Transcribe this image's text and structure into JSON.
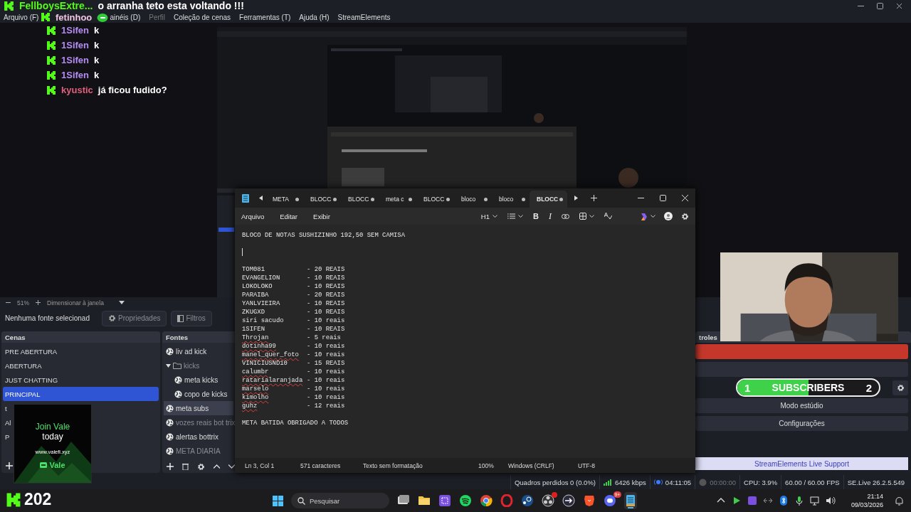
{
  "chat_overlay": {
    "messages": [
      {
        "kind": "title",
        "user": "FellboysExtre...",
        "text": "o arranha teto esta voltando !!!",
        "color": "#53fc18"
      },
      {
        "kind": "emote",
        "user": "fetinhoo",
        "color": "#f2c4e4"
      },
      {
        "kind": "text",
        "user": "1Sifen",
        "text": "k",
        "color": "#b48cf2"
      },
      {
        "kind": "text",
        "user": "1Sifen",
        "text": "k",
        "color": "#b48cf2"
      },
      {
        "kind": "text",
        "user": "1Sifen",
        "text": "k",
        "color": "#b48cf2"
      },
      {
        "kind": "text",
        "user": "1Sifen",
        "text": "k",
        "color": "#b48cf2"
      },
      {
        "kind": "text",
        "user": "kyustic",
        "text": "já ficou fudido?",
        "color": "#e0607e"
      }
    ]
  },
  "menu": [
    {
      "label": "Arquivo (F)",
      "disabled": false
    },
    {
      "label": "ainéis (D)",
      "disabled": false
    },
    {
      "label": "Perfil",
      "disabled": true
    },
    {
      "label": "Coleção de cenas",
      "disabled": false
    },
    {
      "label": "Ferramentas (T)",
      "disabled": false
    },
    {
      "label": "Ajuda (H)",
      "disabled": false
    },
    {
      "label": "StreamElements",
      "disabled": false
    }
  ],
  "preview": {
    "zoom": "51%",
    "fit": "Dimensionar à janela"
  },
  "source_toolbar": {
    "status": "Nenhuma fonte selecionad",
    "buttons": [
      {
        "kind": "properties",
        "label": "Propriedades",
        "disabled": true
      },
      {
        "kind": "filters",
        "label": "Filtros",
        "disabled": true
      }
    ]
  },
  "scenes": {
    "title": "Cenas",
    "items": [
      {
        "label": "PRE ABERTURA",
        "selected": false
      },
      {
        "label": "ABERTURA",
        "selected": false
      },
      {
        "label": "JUST CHATTING",
        "selected": false
      },
      {
        "label": "PRINCIPAL",
        "selected": true
      },
      {
        "label": "t",
        "selected": false
      },
      {
        "label": "Al",
        "selected": false
      },
      {
        "label": "P",
        "selected": false
      }
    ]
  },
  "sources": {
    "title": "Fontes",
    "items": [
      {
        "kind": "browser",
        "label": "liv ad kick",
        "hidden": false,
        "selected": false
      },
      {
        "kind": "folder",
        "label": "kicks",
        "hidden": true,
        "selected": false,
        "expanded": true,
        "children": [
          {
            "kind": "browser",
            "label": "meta kicks",
            "hidden": false,
            "selected": false
          },
          {
            "kind": "browser",
            "label": "copo de kicks",
            "hidden": false,
            "selected": false
          }
        ]
      },
      {
        "kind": "browser",
        "label": "meta subs",
        "hidden": false,
        "selected": true
      },
      {
        "kind": "browser",
        "label": "vozes reais bot trix",
        "hidden": true,
        "selected": false
      },
      {
        "kind": "browser",
        "label": "alertas bottrix",
        "hidden": false,
        "selected": false
      },
      {
        "kind": "browser",
        "label": "META DIARIA",
        "hidden": true,
        "selected": false
      }
    ]
  },
  "notepad": {
    "tabs": [
      {
        "label": "META",
        "selected": false
      },
      {
        "label": "BLOCC",
        "selected": false
      },
      {
        "label": "BLOCC",
        "selected": false
      },
      {
        "label": "meta c",
        "selected": false
      },
      {
        "label": "BLOCC",
        "selected": false
      },
      {
        "label": "bloco",
        "selected": false
      },
      {
        "label": "bloco",
        "selected": false
      },
      {
        "label": "BLOCC",
        "selected": true
      }
    ],
    "menu": [
      "Arquivo",
      "Editar",
      "Exibir"
    ],
    "heading_style": "H1",
    "bold_label": "B",
    "italic_label": "I",
    "heading": "BLOCO DE NOTAS SUSHIZINHO 192,50 SEM CAMISA",
    "entries": [
      {
        "name": "TOM081",
        "amount": "- 20 REAIS",
        "misspelled": false
      },
      {
        "name": "EVANGELION",
        "amount": "- 10 REAIS",
        "misspelled": false
      },
      {
        "name": "LOKOLOKO",
        "amount": "- 10 REAIS",
        "misspelled": false
      },
      {
        "name": "PARAIBA",
        "amount": "- 20 REAIS",
        "misspelled": false
      },
      {
        "name": "YANLVIEIRA",
        "amount": "- 10 REAIS",
        "misspelled": false
      },
      {
        "name": "ZKUGXD",
        "amount": "- 10 REAIS",
        "misspelled": false
      },
      {
        "name": "siri sacudo",
        "amount": "- 10 reais",
        "misspelled": false
      },
      {
        "name": "1SIFEN",
        "amount": "- 10 REAIS",
        "misspelled": false
      },
      {
        "name": "Throjan",
        "amount": "- 5 reais",
        "misspelled": true
      },
      {
        "name": "dotinha99",
        "amount": "- 10 reais",
        "misspelled": true
      },
      {
        "name": "manel_quer_foto",
        "amount": "- 10 reais",
        "misspelled": true
      },
      {
        "name": "VINICIUSND10",
        "amount": "- 15 REAIS",
        "misspelled": false
      },
      {
        "name": "calumbr",
        "amount": "- 10 reais",
        "misspelled": true
      },
      {
        "name": "ratarialaranjada",
        "amount": "- 10 reais",
        "misspelled": true
      },
      {
        "name": "marselo",
        "amount": "- 10 reais",
        "misspelled": true
      },
      {
        "name": "kimolho",
        "amount": "- 10 reais",
        "misspelled": true
      },
      {
        "name": "guhz",
        "amount": "- 12 reais",
        "misspelled": true
      }
    ],
    "footer": "META BATIDA OBRIGADO A TODOS",
    "status": [
      "Ln 3, Col 1",
      "571 caracteres",
      "Texto sem formatação",
      "100%",
      "Windows (CRLF)",
      "UTF-8"
    ]
  },
  "controls": {
    "title": "troles",
    "buttons": [
      {
        "kind": "live"
      },
      {
        "kind": "plain"
      },
      {
        "kind": "settings"
      },
      {
        "kind": "plain",
        "label": "Modo estúdio"
      },
      {
        "kind": "plain",
        "label": "Configurações"
      }
    ],
    "support": "StreamElements Live Support"
  },
  "subscribers": {
    "current": "1",
    "label": "SUBSCRIBERS",
    "goal": "2",
    "level": 0.5
  },
  "ad": {
    "headline": "Join Vale",
    "subline": "today",
    "url": "www.valefi.xyz",
    "brand": "Vale"
  },
  "kick_counter": {
    "count": "202"
  },
  "status_bar": [
    {
      "kind": "plain",
      "text": "Quadros perdidos 0 (0.0%)"
    },
    {
      "kind": "bitrate",
      "text": "6426 kbps"
    },
    {
      "kind": "stream",
      "text": "04:11:05",
      "on": true
    },
    {
      "kind": "record",
      "text": "00:00:00",
      "on": false
    },
    {
      "kind": "plain",
      "text": "CPU: 3.9%"
    },
    {
      "kind": "plain",
      "text": "60.00 / 60.00 FPS"
    },
    {
      "kind": "plain",
      "text": "SE.Live 26.2.5.549"
    }
  ],
  "taskbar": {
    "search": {
      "placeholder": "Pesquisar"
    },
    "apps": [
      {
        "kind": "taskview",
        "selected": false,
        "alert": false
      },
      {
        "kind": "files",
        "selected": false,
        "alert": false
      },
      {
        "kind": "grid",
        "selected": false,
        "alert": false
      },
      {
        "kind": "waves",
        "selected": false,
        "alert": false
      },
      {
        "kind": "ring",
        "selected": false,
        "alert": false
      },
      {
        "kind": "oring",
        "selected": false,
        "alert": false
      },
      {
        "kind": "disc",
        "selected": false,
        "alert": false
      },
      {
        "kind": "rec",
        "selected": false,
        "alert": true
      },
      {
        "kind": "arrow",
        "selected": false,
        "alert": false
      },
      {
        "kind": "shield",
        "selected": false,
        "alert": false
      },
      {
        "kind": "chat",
        "selected": false,
        "alert": false,
        "badge": "9+"
      },
      {
        "kind": "notepad",
        "selected": true,
        "alert": false
      }
    ],
    "tray": [
      {
        "kind": "chevron"
      },
      {
        "kind": "play"
      },
      {
        "kind": "square"
      },
      {
        "kind": "arrows"
      },
      {
        "kind": "bluetooth"
      },
      {
        "kind": "mic"
      },
      {
        "kind": "network"
      },
      {
        "kind": "volume"
      }
    ],
    "clock": {
      "time": "21:14",
      "date": "09/03/2026"
    }
  }
}
